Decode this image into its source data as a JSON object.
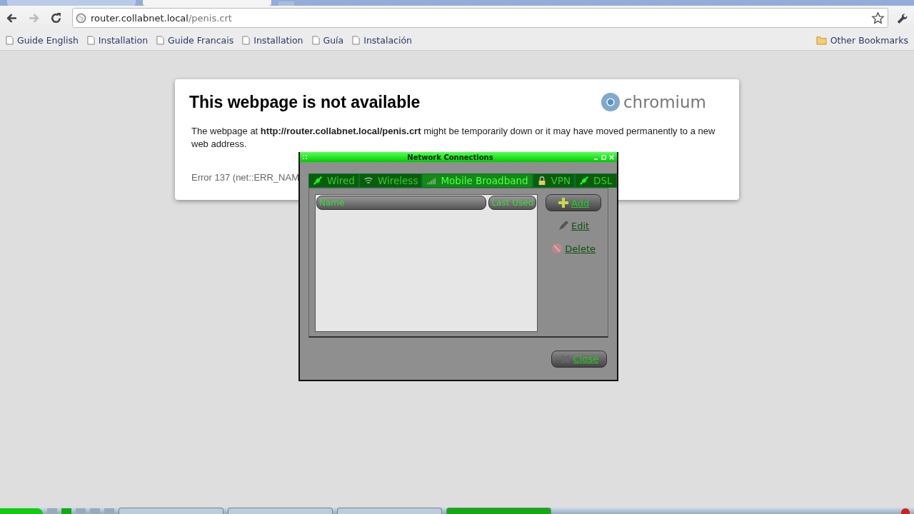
{
  "browser": {
    "address": {
      "host": "router.collabnet.local",
      "path": "/penis.crt"
    },
    "bookmarks": [
      "Guide English",
      "Installation",
      "Guide Francais",
      "Installation",
      "Guía",
      "Instalación"
    ],
    "other_bookmarks": "Other Bookmarks"
  },
  "error_page": {
    "title": "This webpage is not available",
    "logo": "chromium",
    "message": "The webpage at **http://router.collabnet.local/penis.crt** might be temporarily down or it may have moved permanently to a new web address.",
    "error_code": "Error 137 (net::ERR_NAM"
  },
  "dialog": {
    "title": "Network Connections",
    "tabs": [
      {
        "label": "Wired",
        "kind": "wired",
        "selected": false
      },
      {
        "label": "Wireless",
        "kind": "wireless",
        "selected": false
      },
      {
        "label": "Mobile Broadband",
        "kind": "mobile",
        "selected": true
      },
      {
        "label": "VPN",
        "kind": "vpn",
        "selected": false
      },
      {
        "label": "DSL",
        "kind": "dsl",
        "selected": false
      }
    ],
    "columns": [
      "Name",
      "Last Used"
    ],
    "buttons": [
      {
        "label": "Add",
        "kind": "add",
        "disabled": false
      },
      {
        "label": "Edit",
        "kind": "edit",
        "disabled": true
      },
      {
        "label": "Delete",
        "kind": "delete",
        "disabled": true
      }
    ],
    "close_button": "Close"
  }
}
